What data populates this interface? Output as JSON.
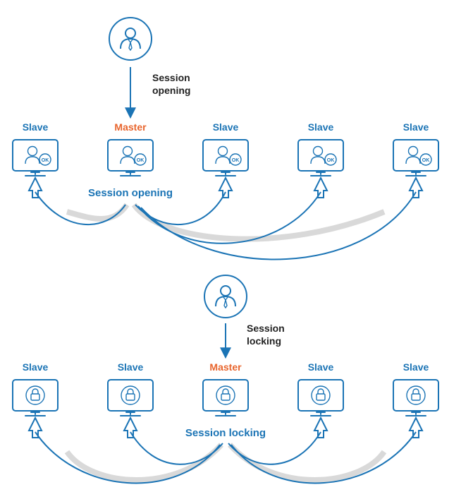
{
  "colors": {
    "blue": "#1b74b5",
    "orange": "#e8652d"
  },
  "top": {
    "user_arrow": "Session opening",
    "nodes": [
      {
        "role": "Slave",
        "screen": "user-ok"
      },
      {
        "role": "Master",
        "screen": "user-ok"
      },
      {
        "role": "Slave",
        "screen": "user-ok"
      },
      {
        "role": "Slave",
        "screen": "user-ok"
      },
      {
        "role": "Slave",
        "screen": "user-ok"
      }
    ],
    "caption": "Session opening"
  },
  "bottom": {
    "user_arrow": "Session locking",
    "nodes": [
      {
        "role": "Slave",
        "screen": "lock"
      },
      {
        "role": "Slave",
        "screen": "lock"
      },
      {
        "role": "Master",
        "screen": "lock"
      },
      {
        "role": "Slave",
        "screen": "lock"
      },
      {
        "role": "Slave",
        "screen": "lock"
      }
    ],
    "caption": "Session locking"
  }
}
